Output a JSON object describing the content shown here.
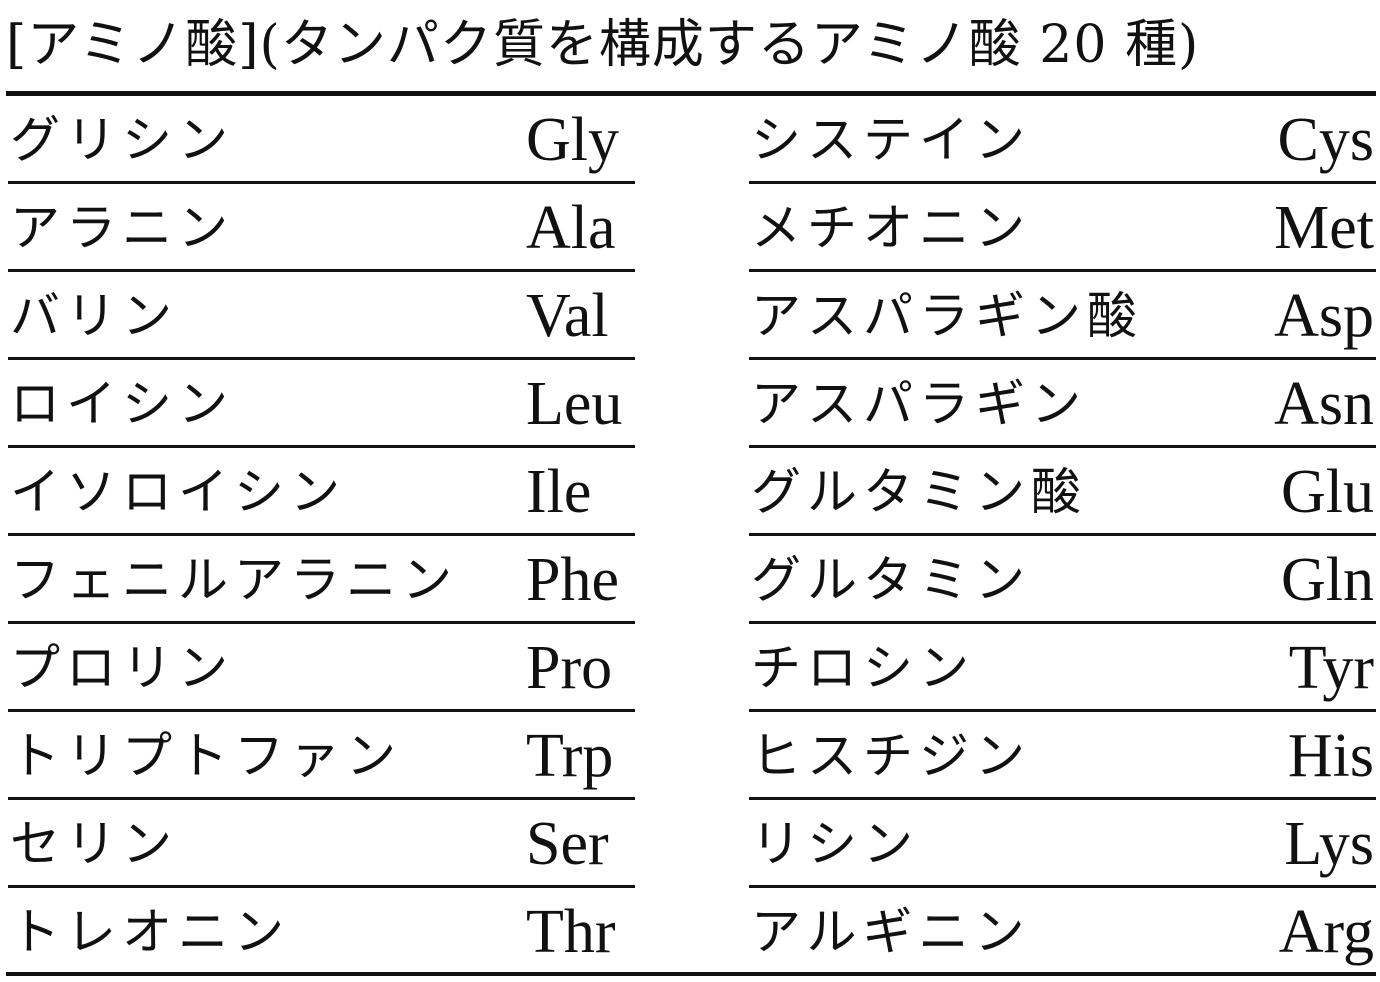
{
  "title": "[アミノ酸](タンパク質を構成するアミノ酸 20 種)",
  "table": {
    "left": [
      {
        "name": "グリシン",
        "abbr": "Gly"
      },
      {
        "name": "アラニン",
        "abbr": "Ala"
      },
      {
        "name": "バリン",
        "abbr": "Val"
      },
      {
        "name": "ロイシン",
        "abbr": "Leu"
      },
      {
        "name": "イソロイシン",
        "abbr": "Ile"
      },
      {
        "name": "フェニルアラニン",
        "abbr": "Phe"
      },
      {
        "name": "プロリン",
        "abbr": "Pro"
      },
      {
        "name": "トリプトファン",
        "abbr": "Trp"
      },
      {
        "name": "セリン",
        "abbr": "Ser"
      },
      {
        "name": "トレオニン",
        "abbr": "Thr"
      }
    ],
    "right": [
      {
        "name": "システイン",
        "abbr": "Cys"
      },
      {
        "name": "メチオニン",
        "abbr": "Met"
      },
      {
        "name": "アスパラギン酸",
        "abbr": "Asp"
      },
      {
        "name": "アスパラギン",
        "abbr": "Asn"
      },
      {
        "name": "グルタミン酸",
        "abbr": "Glu"
      },
      {
        "name": "グルタミン",
        "abbr": "Gln"
      },
      {
        "name": "チロシン",
        "abbr": "Tyr"
      },
      {
        "name": "ヒスチジン",
        "abbr": "His"
      },
      {
        "name": "リシン",
        "abbr": "Lys"
      },
      {
        "name": "アルギニン",
        "abbr": "Arg"
      }
    ]
  }
}
